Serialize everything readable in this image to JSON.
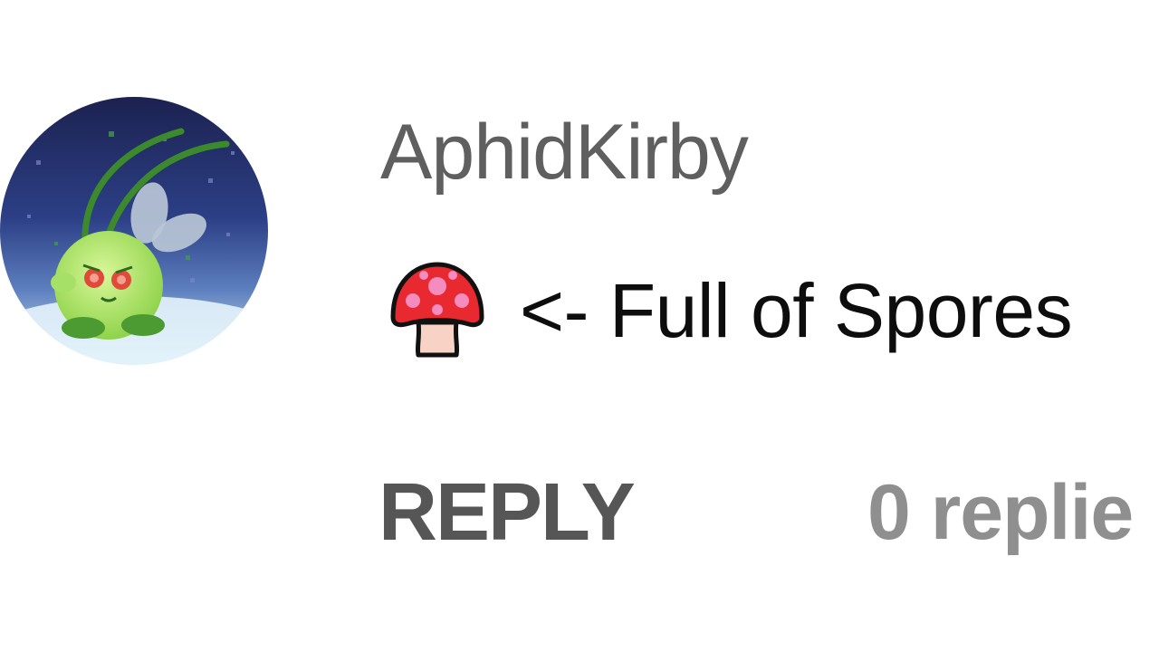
{
  "comment": {
    "author": "AphidKirby",
    "avatar_icon": "aphid-kirby-avatar",
    "emoji_icon": "mushroom-emoji",
    "text": "<- Full of Spores"
  },
  "actions": {
    "reply_label": "REPLY",
    "replies_count": "0 replie"
  },
  "colors": {
    "author": "#5f5f5f",
    "text": "#0d0d0d",
    "reply": "#565656",
    "replies": "#8f8f8f",
    "mushroom_cap": "#e8292f",
    "mushroom_spots": "#f48cc0",
    "mushroom_stem": "#f6d3c4"
  }
}
